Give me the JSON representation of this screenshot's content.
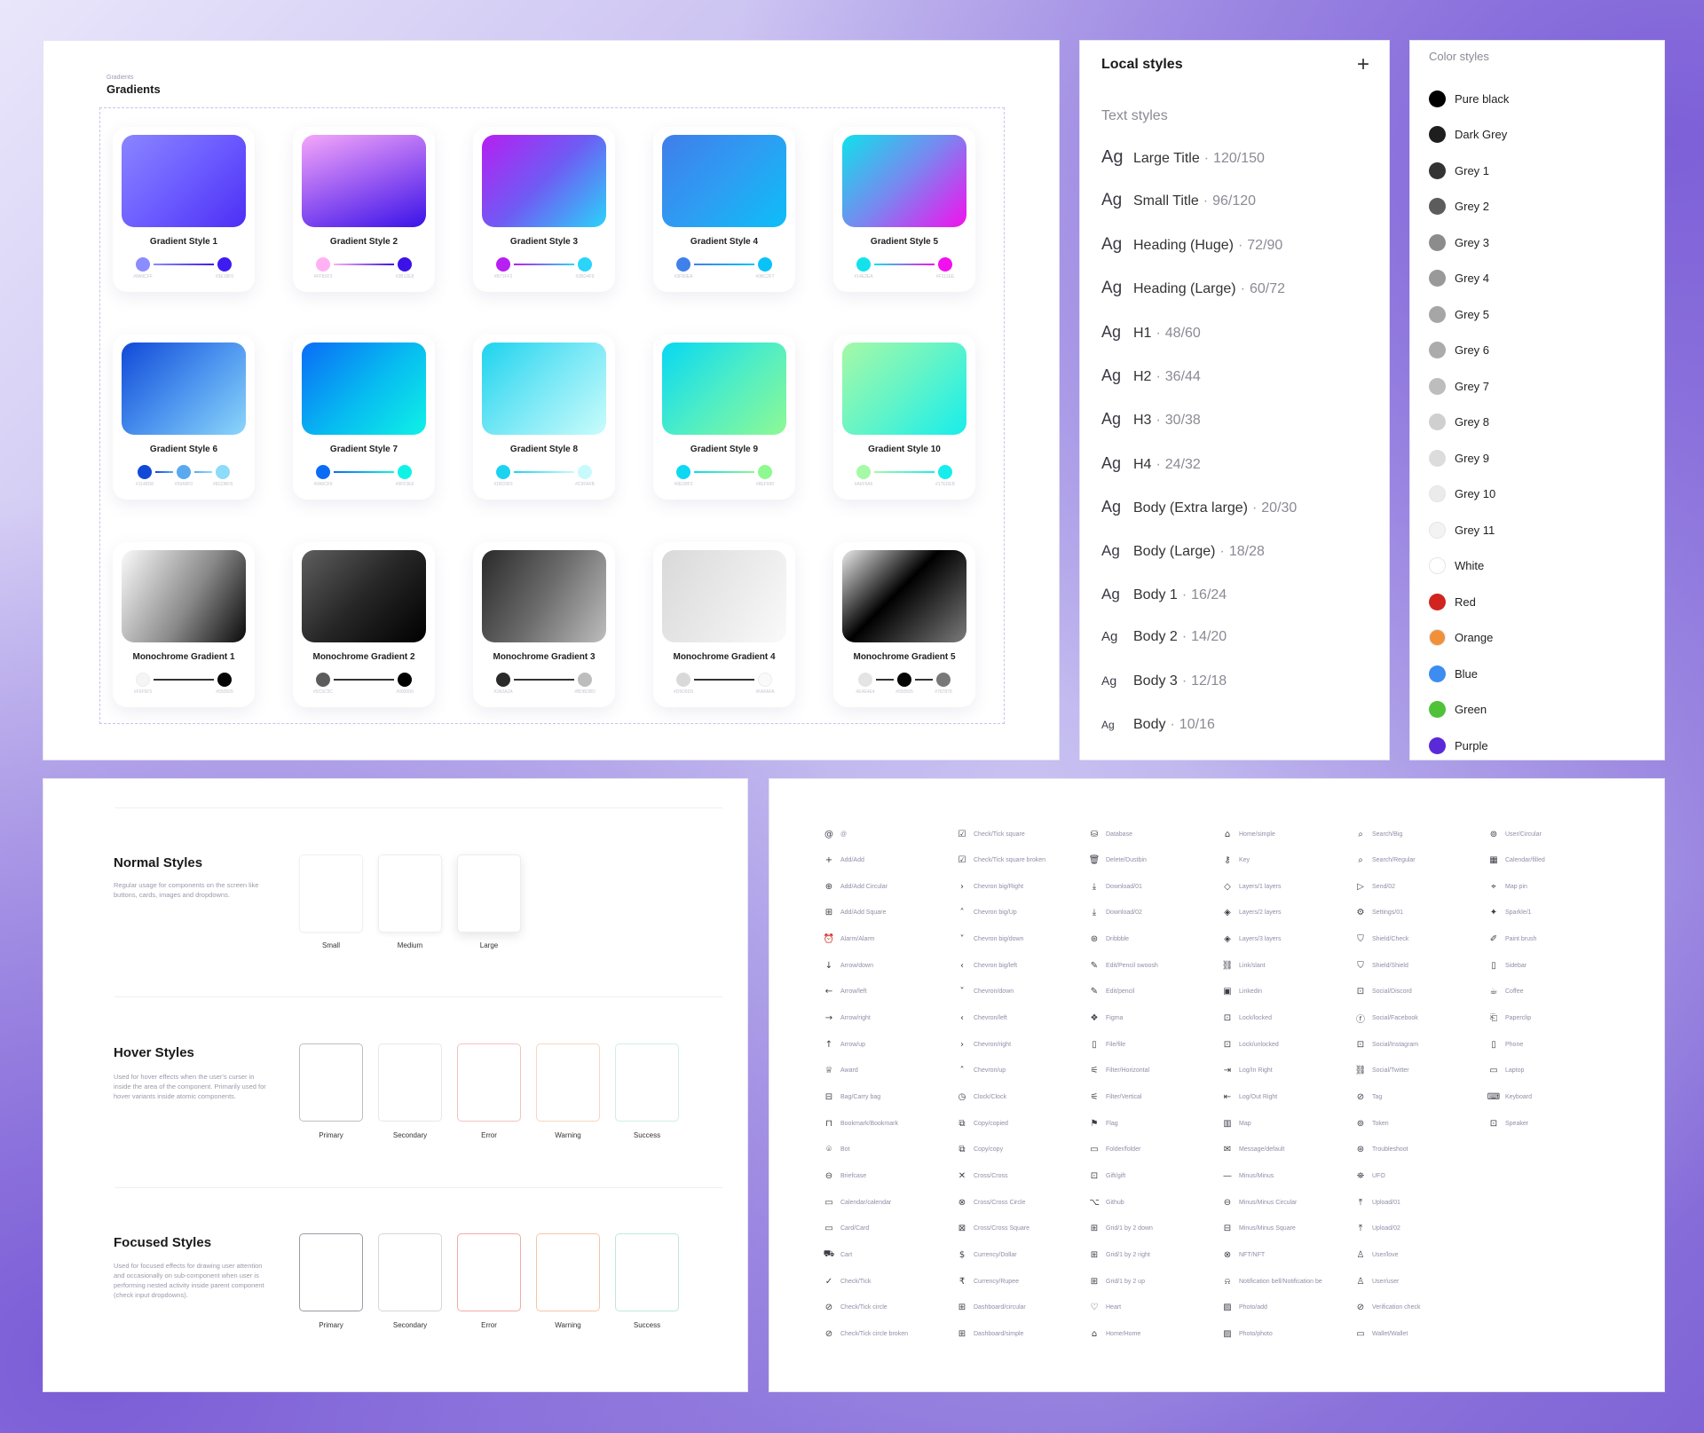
{
  "gradients": {
    "section_small": "Gradients",
    "title": "Gradients",
    "cards": [
      {
        "name": "Gradient Style 1",
        "g": "linear-gradient(135deg,#8A85FF 0%,#6C5CFF 50%,#4D2FF5 100%)",
        "stops": [
          "#8A8CFF",
          "#3E1BF0"
        ],
        "hex": [
          "#8A8CFF",
          "#3E18F0"
        ]
      },
      {
        "name": "Gradient Style 2",
        "g": "linear-gradient(160deg,#F5A6F9 0%,#9A5BF2 50%,#3B13E8 100%)",
        "stops": [
          "#FFB1F3",
          "#3B12E8"
        ],
        "hex": [
          "#FFB3F3",
          "#3B12E8"
        ]
      },
      {
        "name": "Gradient Style 3",
        "g": "linear-gradient(135deg,#B61FF2 0%,#6E5CF4 50%,#2BD2F9 100%)",
        "stops": [
          "#B71FF2",
          "#2BD4F9"
        ],
        "hex": [
          "#B71FF2",
          "#2BD4F9"
        ]
      },
      {
        "name": "Gradient Style 4",
        "g": "linear-gradient(135deg,#3F7EEA 0%,#2E9DF3 50%,#0DBEF7 100%)",
        "stops": [
          "#3F80EA",
          "#0BC2F7"
        ],
        "hex": [
          "#3F80EA",
          "#0BC2F7"
        ]
      },
      {
        "name": "Gradient Style 5",
        "g": "linear-gradient(135deg,#10E1EA 0%,#7A86F0 50%,#F211EE 100%)",
        "stops": [
          "#14E2EA",
          "#F211EE"
        ],
        "hex": [
          "#14E2EA",
          "#F211EE"
        ]
      },
      {
        "name": "Gradient Style 6",
        "g": "linear-gradient(135deg,#1149D8 0%,#4A92EE 50%,#8CD6FA 100%)",
        "stops": [
          "#1148D8",
          "#59A9F0",
          "#8CDBF8"
        ],
        "hex": [
          "#1148D8",
          "#59A9F0",
          "#8CDBF8"
        ]
      },
      {
        "name": "Gradient Style 7",
        "g": "linear-gradient(135deg,#0A6CF6 0%,#07B7F1 50%,#0FF2E6 100%)",
        "stops": [
          "#0A6CF6",
          "#0FF3E6"
        ],
        "hex": [
          "#0A6CF6",
          "#0FF3E6"
        ]
      },
      {
        "name": "Gradient Style 8",
        "g": "linear-gradient(135deg,#1ED3EE 0%,#7AE8F6 50%,#C9FCFB 100%)",
        "stops": [
          "#1BD3F0",
          "#C9FAFB"
        ],
        "hex": [
          "#1BD3F0",
          "#C9FAFB"
        ]
      },
      {
        "name": "Gradient Style 9",
        "g": "linear-gradient(135deg,#07D8F2 0%,#4EEDC6 50%,#8EF994 100%)",
        "stops": [
          "#0ED8F2",
          "#8EF990"
        ],
        "hex": [
          "#0ED8F2",
          "#8EF990"
        ]
      },
      {
        "name": "Gradient Style 10",
        "g": "linear-gradient(135deg,#A6F9A6 0%,#63F4C8 50%,#17EDEB 100%)",
        "stops": [
          "#A6F9A6",
          "#17EDEB"
        ],
        "hex": [
          "#A6F9A6",
          "#17EDEB"
        ]
      },
      {
        "name": "Monochrome Gradient 1",
        "g": "linear-gradient(120deg,#FAFAFA 0%,#8A8A8A 55%,#0A0A0A 100%)",
        "stops": [
          "#F5F5F5",
          "#050505"
        ],
        "hex": [
          "#F5F5F5",
          "#050505"
        ]
      },
      {
        "name": "Monochrome Gradient 2",
        "g": "linear-gradient(135deg,#5E5E5E 0%,#262626 50%,#000000 100%)",
        "stops": [
          "#5C5C5C",
          "#000000"
        ],
        "hex": [
          "#5C5C5C",
          "#000000"
        ]
      },
      {
        "name": "Monochrome Gradient 3",
        "g": "linear-gradient(120deg,#2A2A2A 0%,#6B6B6B 50%,#BDBDBD 100%)",
        "stops": [
          "#2A2A2A",
          "#BDBDBD"
        ],
        "hex": [
          "#2A2A2A",
          "#BDBDBD"
        ]
      },
      {
        "name": "Monochrome Gradient 4",
        "g": "linear-gradient(120deg,#D9D9D9 0%,#ECECEC 60%,#FAFAFA 100%)",
        "stops": [
          "#D9D9D9",
          "#FAFAFA"
        ],
        "hex": [
          "#D9D9D9",
          "#FAFAFA"
        ]
      },
      {
        "name": "Monochrome Gradient 5",
        "g": "linear-gradient(135deg,#EAEAEA 0%,#000000 45%,#7A7A7A 100%)",
        "stops": [
          "#E4E4E4",
          "#050505",
          "#787878"
        ],
        "hex": [
          "#E4E4E4",
          "#050505",
          "#787878"
        ]
      }
    ]
  },
  "local_styles": {
    "title": "Local styles",
    "add_icon": "plus-icon",
    "subtitle": "Text styles",
    "text_styles": [
      {
        "ag": "Ag",
        "name": "Large Title",
        "size": "120/150",
        "agsize": 20
      },
      {
        "ag": "Ag",
        "name": "Small Title",
        "size": "96/120",
        "agsize": 19
      },
      {
        "ag": "Ag",
        "name": "Heading (Huge)",
        "size": "72/90",
        "agsize": 19
      },
      {
        "ag": "Ag",
        "name": "Heading (Large)",
        "size": "60/72",
        "agsize": 19
      },
      {
        "ag": "Ag",
        "name": "H1",
        "size": "48/60",
        "agsize": 18
      },
      {
        "ag": "Ag",
        "name": "H2",
        "size": "36/44",
        "agsize": 18
      },
      {
        "ag": "Ag",
        "name": "H3",
        "size": "30/38",
        "agsize": 18
      },
      {
        "ag": "Ag",
        "name": "H4",
        "size": "24/32",
        "agsize": 18
      },
      {
        "ag": "Ag",
        "name": "Body (Extra large)",
        "size": "20/30",
        "agsize": 18
      },
      {
        "ag": "Ag",
        "name": "Body (Large)",
        "size": "18/28",
        "agsize": 17
      },
      {
        "ag": "Ag",
        "name": "Body 1",
        "size": "16/24",
        "agsize": 17
      },
      {
        "ag": "Ag",
        "name": "Body 2",
        "size": "14/20",
        "agsize": 15
      },
      {
        "ag": "Ag",
        "name": "Body 3",
        "size": "12/18",
        "agsize": 14
      },
      {
        "ag": "Ag",
        "name": "Body",
        "size": "10/16",
        "agsize": 12
      }
    ]
  },
  "color_styles": {
    "title": "Color styles",
    "items": [
      {
        "name": "Pure black",
        "color": "#000000"
      },
      {
        "name": "Dark Grey",
        "color": "#1E1E1E"
      },
      {
        "name": "Grey 1",
        "color": "#333333"
      },
      {
        "name": "Grey 2",
        "color": "#5C5C5C"
      },
      {
        "name": "Grey 3",
        "color": "#8C8C8C"
      },
      {
        "name": "Grey 4",
        "color": "#999999"
      },
      {
        "name": "Grey 5",
        "color": "#A6A6A6"
      },
      {
        "name": "Grey 6",
        "color": "#ABABAB"
      },
      {
        "name": "Grey 7",
        "color": "#BDBDBD"
      },
      {
        "name": "Grey 8",
        "color": "#CFCFCF"
      },
      {
        "name": "Grey 9",
        "color": "#DCDCDC"
      },
      {
        "name": "Grey 10",
        "color": "#EBEBEB"
      },
      {
        "name": "Grey 11",
        "color": "#F3F3F3"
      },
      {
        "name": "White",
        "color": "#FFFFFF"
      },
      {
        "name": "Red",
        "color": "#D1241E"
      },
      {
        "name": "Orange",
        "color": "#F0913A"
      },
      {
        "name": "Blue",
        "color": "#3D8CF0"
      },
      {
        "name": "Green",
        "color": "#4FC23A"
      },
      {
        "name": "Purple",
        "color": "#5A2AD9"
      }
    ]
  },
  "component_styles": {
    "normal": {
      "title": "Normal Styles",
      "desc": "Regular usage for components on the screen like buttons, cards, images and dropdowns.",
      "boxes": [
        "Small",
        "Medium",
        "Large"
      ]
    },
    "hover": {
      "title": "Hover Styles",
      "desc": "Used for hover effects when the user's curser in inside the area of the component. Primarily used for hover variants inside atomic components.",
      "boxes": [
        {
          "label": "Primary",
          "border": "#bdbdc4"
        },
        {
          "label": "Secondary",
          "border": "#e7e7ec"
        },
        {
          "label": "Error",
          "border": "#f5c2bf"
        },
        {
          "label": "Warning",
          "border": "#f7d7c1"
        },
        {
          "label": "Success",
          "border": "#cfeee8"
        }
      ]
    },
    "focused": {
      "title": "Focused Styles",
      "desc": "Used for focused effects for drawing user attention and occasionally on sub-component when user is performing nested activity inside parent component (check input dropdowns).",
      "boxes": [
        {
          "label": "Primary",
          "border": "#9c9ca4"
        },
        {
          "label": "Secondary",
          "border": "#d6d6dd"
        },
        {
          "label": "Error",
          "border": "#f3aaa6"
        },
        {
          "label": "Warning",
          "border": "#f5c6a6"
        },
        {
          "label": "Success",
          "border": "#bfe7df"
        }
      ]
    }
  },
  "icons": {
    "columns": [
      [
        [
          "@",
          "@"
        ],
        [
          "+",
          "Add/Add"
        ],
        [
          "⊕",
          "Add/Add Circular"
        ],
        [
          "⊞",
          "Add/Add Square"
        ],
        [
          "⏰",
          "Alarm/Alarm"
        ],
        [
          "↓",
          "Arrow/down"
        ],
        [
          "←",
          "Arrow/left"
        ],
        [
          "→",
          "Arrow/right"
        ],
        [
          "↑",
          "Arrow/up"
        ],
        [
          "♕",
          "Award"
        ],
        [
          "⊟",
          "Bag/Carry bag"
        ],
        [
          "⊓",
          "Bookmark/Bookmark"
        ],
        [
          "⌾",
          "Bot"
        ],
        [
          "⊖",
          "Briefcase"
        ],
        [
          "▭",
          "Calendar/calendar"
        ],
        [
          "▭",
          "Card/Card"
        ],
        [
          "⛟",
          "Cart"
        ],
        [
          "✓",
          "Check/Tick"
        ],
        [
          "⊘",
          "Check/Tick circle"
        ],
        [
          "⊘",
          "Check/Tick circle broken"
        ]
      ],
      [
        [
          "☑",
          "Check/Tick square"
        ],
        [
          "☑",
          "Check/Tick square broken"
        ],
        [
          "›",
          "Chevron big/Right"
        ],
        [
          "˄",
          "Chevron big/Up"
        ],
        [
          "˅",
          "Chevron big/down"
        ],
        [
          "‹",
          "Chevron big/left"
        ],
        [
          "˅",
          "Chevron/down"
        ],
        [
          "‹",
          "Chevron/left"
        ],
        [
          "›",
          "Chevron/right"
        ],
        [
          "˄",
          "Chevron/up"
        ],
        [
          "◷",
          "Clock/Clock"
        ],
        [
          "⧉",
          "Copy/copied"
        ],
        [
          "⧉",
          "Copy/copy"
        ],
        [
          "✕",
          "Cross/Cross"
        ],
        [
          "⊗",
          "Cross/Cross Circle"
        ],
        [
          "⊠",
          "Cross/Cross Square"
        ],
        [
          "$",
          "Currency/Dollar"
        ],
        [
          "₹",
          "Currency/Rupee"
        ],
        [
          "⊞",
          "Dashboard/circular"
        ],
        [
          "⊞",
          "Dashboard/simple"
        ]
      ],
      [
        [
          "⛁",
          "Database"
        ],
        [
          "🗑",
          "Delete/Dustbin"
        ],
        [
          "⤓",
          "Download/01"
        ],
        [
          "⤓",
          "Download/02"
        ],
        [
          "⊛",
          "Dribbble"
        ],
        [
          "✎",
          "Edit/Pencil swoosh"
        ],
        [
          "✎",
          "Edit/pencil"
        ],
        [
          "❖",
          "Figma"
        ],
        [
          "▯",
          "File/file"
        ],
        [
          "⚟",
          "Filter/Horizontal"
        ],
        [
          "⚟",
          "Filter/Vertical"
        ],
        [
          "⚑",
          "Flag"
        ],
        [
          "▭",
          "Folder/folder"
        ],
        [
          "⊡",
          "Gift/gift"
        ],
        [
          "⌥",
          "Github"
        ],
        [
          "⊞",
          "Grid/1 by 2 down"
        ],
        [
          "⊞",
          "Grid/1 by 2 right"
        ],
        [
          "⊞",
          "Grid/1 by 2 up"
        ],
        [
          "♡",
          "Heart"
        ],
        [
          "⌂",
          "Home/Home"
        ]
      ],
      [
        [
          "⌂",
          "Home/simple"
        ],
        [
          "⚷",
          "Key"
        ],
        [
          "◇",
          "Layers/1 layers"
        ],
        [
          "◈",
          "Layers/2 layers"
        ],
        [
          "◈",
          "Layers/3 layers"
        ],
        [
          "⛓",
          "Link/slant"
        ],
        [
          "▣",
          "Linkedin"
        ],
        [
          "⊡",
          "Lock/locked"
        ],
        [
          "⊡",
          "Lock/unlocked"
        ],
        [
          "⇥",
          "Log/In Right"
        ],
        [
          "⇤",
          "Log/Out Right"
        ],
        [
          "▥",
          "Map"
        ],
        [
          "✉",
          "Message/default"
        ],
        [
          "—",
          "Minus/Minus"
        ],
        [
          "⊖",
          "Minus/Minus Circular"
        ],
        [
          "⊟",
          "Minus/Minus Square"
        ],
        [
          "⊗",
          "NFT/NFT"
        ],
        [
          "⍾",
          "Notification bell/Notification be"
        ],
        [
          "▨",
          "Photo/add"
        ],
        [
          "▨",
          "Photo/photo"
        ]
      ],
      [
        [
          "⌕",
          "Search/Big"
        ],
        [
          "⌕",
          "Search/Regular"
        ],
        [
          "▷",
          "Send/02"
        ],
        [
          "⚙",
          "Settings/01"
        ],
        [
          "⛉",
          "Shield/Check"
        ],
        [
          "⛉",
          "Shield/Shield"
        ],
        [
          "⊡",
          "Social/Discord"
        ],
        [
          "ⓕ",
          "Social/Facebook"
        ],
        [
          "⊡",
          "Social/Instagram"
        ],
        [
          "⛓",
          "Social/Twitter"
        ],
        [
          "⊘",
          "Tag"
        ],
        [
          "⊚",
          "Token"
        ],
        [
          "⊛",
          "Troubleshoot"
        ],
        [
          "⛯",
          "UFO"
        ],
        [
          "⤒",
          "Upload/01"
        ],
        [
          "⤒",
          "Upload/02"
        ],
        [
          "♙",
          "User/love"
        ],
        [
          "♙",
          "User/user"
        ],
        [
          "⊘",
          "Verification check"
        ],
        [
          "▭",
          "Wallet/Wallet"
        ]
      ],
      [
        [
          "⊚",
          "User/Circular"
        ],
        [
          "▦",
          "Calendar/filled"
        ],
        [
          "⌖",
          "Map pin"
        ],
        [
          "✦",
          "Sparkle/1"
        ],
        [
          "✐",
          "Paint brush"
        ],
        [
          "▯",
          "Sidebar"
        ],
        [
          "☕",
          "Coffee"
        ],
        [
          "⎗",
          "Paperclip"
        ],
        [
          "▯",
          "Phone"
        ],
        [
          "▭",
          "Laptop"
        ],
        [
          "⌨",
          "Keyboard"
        ],
        [
          "⊡",
          "Speaker"
        ]
      ]
    ]
  }
}
